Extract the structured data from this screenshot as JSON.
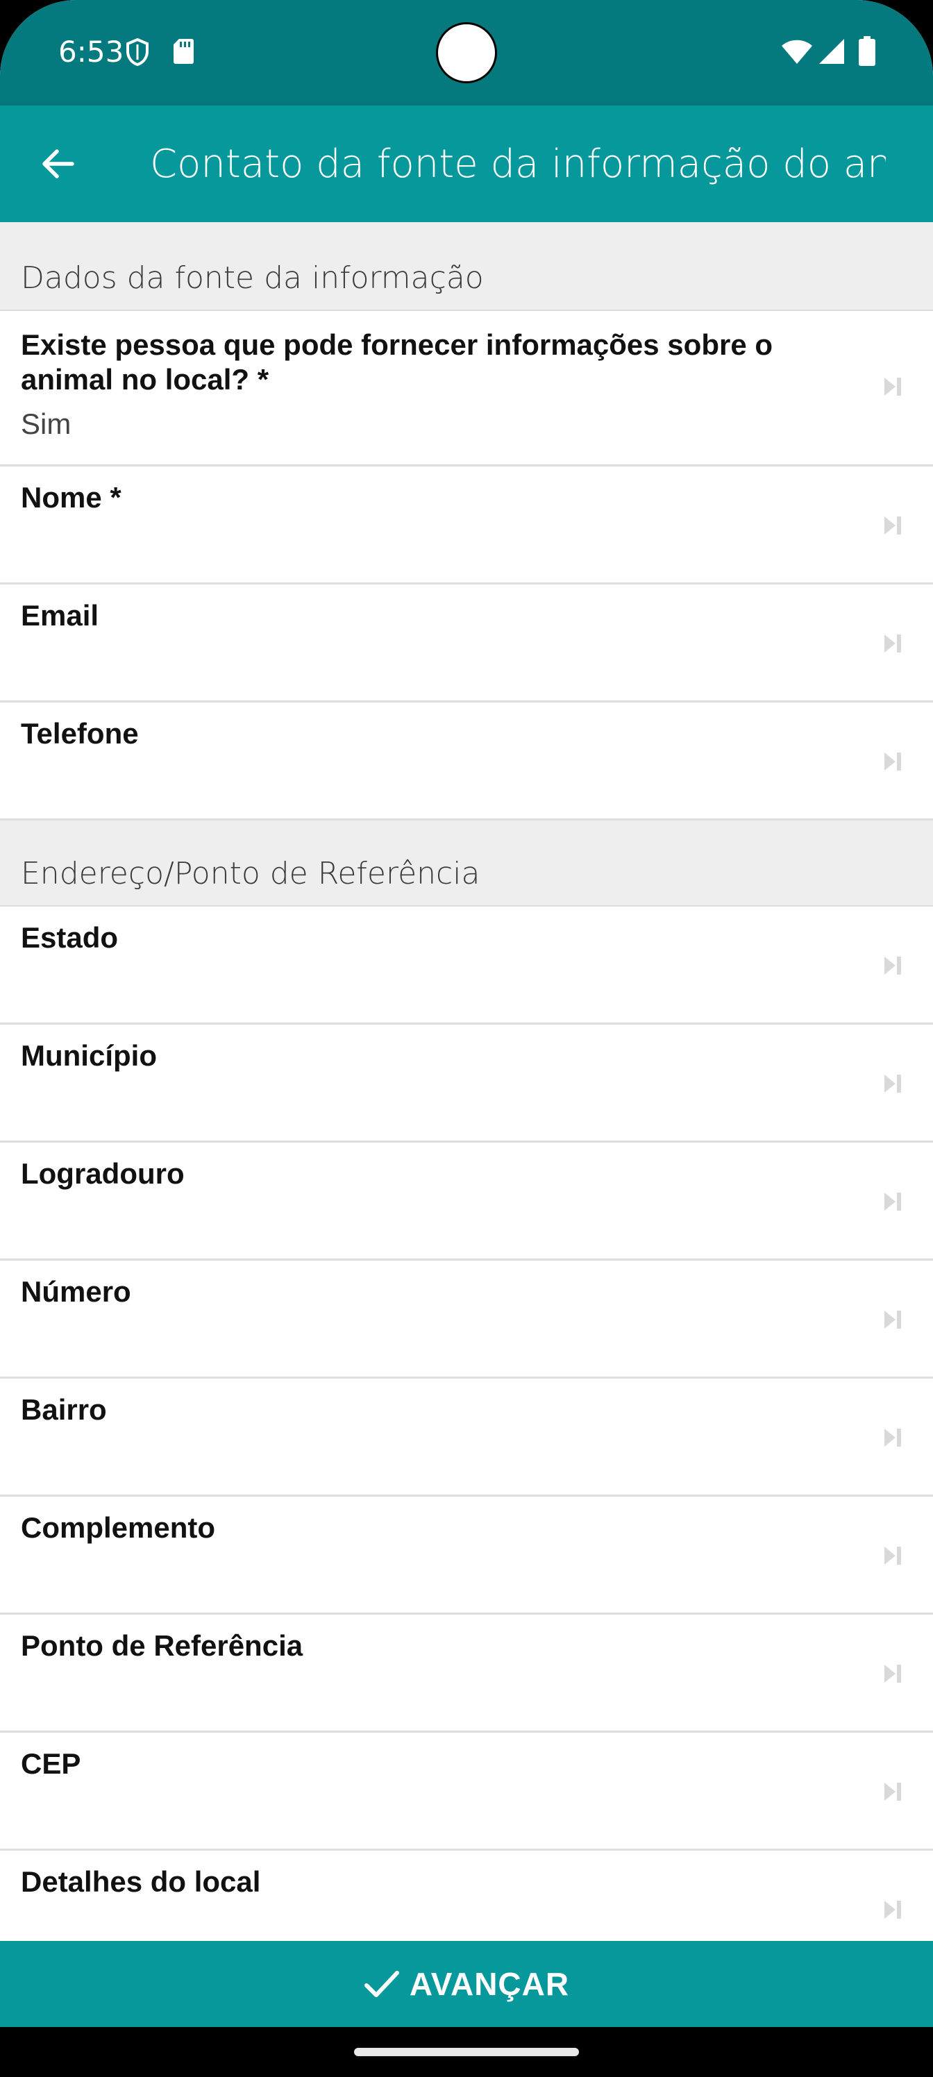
{
  "status_bar": {
    "time": "6:53",
    "icons": [
      "shield-icon",
      "sd-card-icon",
      "wifi-icon",
      "signal-icon",
      "battery-icon"
    ]
  },
  "app_bar": {
    "title": "Contato da fonte da informação do ani…",
    "back_icon": "arrow-left-icon"
  },
  "colors": {
    "status_bar": "#047a7e",
    "app_bar": "#07989c",
    "section_bg": "#eeeeee"
  },
  "sections": [
    {
      "header": "Dados da fonte da informação",
      "fields": [
        {
          "label": "Existe pessoa que pode fornecer informações sobre o animal no local? *",
          "value": "Sim"
        },
        {
          "label": "Nome *",
          "value": ""
        },
        {
          "label": "Email",
          "value": ""
        },
        {
          "label": "Telefone",
          "value": ""
        }
      ]
    },
    {
      "header": "Endereço/Ponto de Referência",
      "fields": [
        {
          "label": "Estado",
          "value": ""
        },
        {
          "label": "Município",
          "value": ""
        },
        {
          "label": "Logradouro",
          "value": ""
        },
        {
          "label": "Número",
          "value": ""
        },
        {
          "label": "Bairro",
          "value": ""
        },
        {
          "label": "Complemento",
          "value": ""
        },
        {
          "label": "Ponto de Referência",
          "value": ""
        },
        {
          "label": "CEP",
          "value": ""
        },
        {
          "label": "Detalhes do local",
          "value": ""
        }
      ]
    }
  ],
  "advance_button": {
    "label": "AVANÇAR",
    "icon": "check-icon"
  }
}
